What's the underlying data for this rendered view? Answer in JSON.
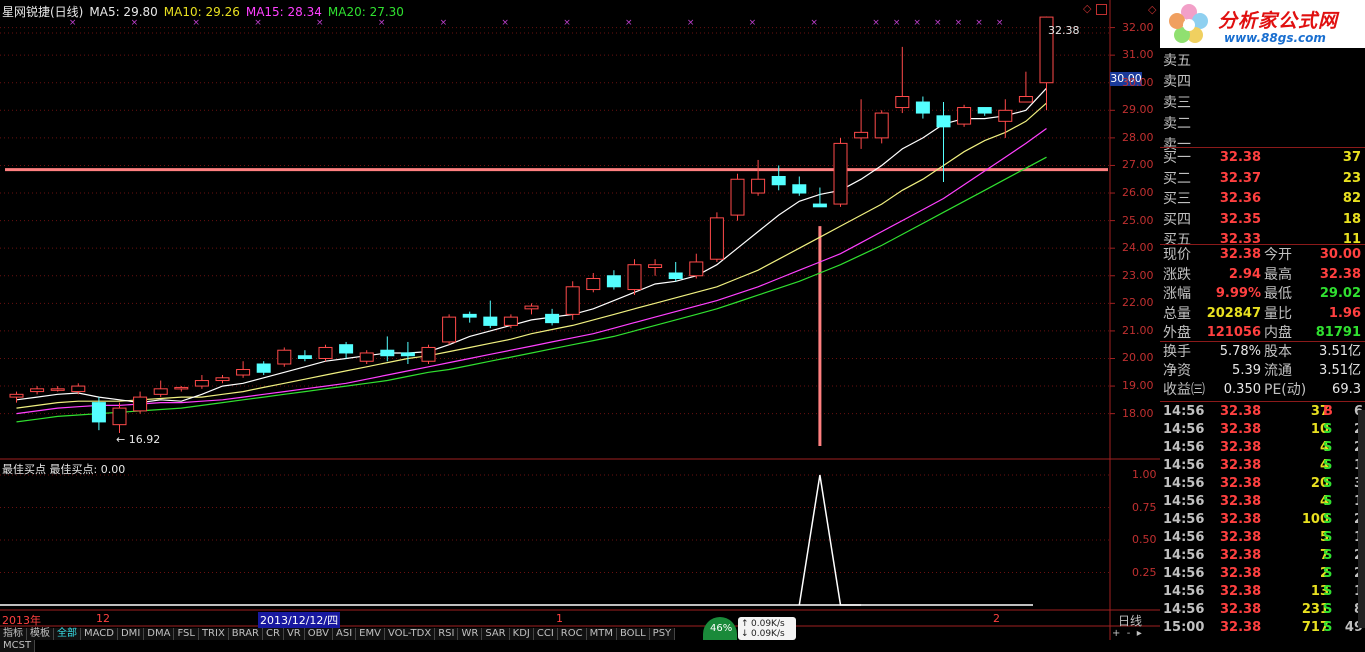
{
  "legend": {
    "name": "星网锐捷(日线)",
    "ma5": "MA5: 29.80",
    "ma10": "MA10: 29.26",
    "ma15": "MA15: 28.34",
    "ma20": "MA20: 27.30",
    "colors": {
      "ma5": "#ffffff",
      "ma10": "#f0f080",
      "ma15": "#ff40ff",
      "ma20": "#30e030"
    }
  },
  "price_axis": [
    "32.00",
    "31.00",
    "30.00",
    "29.00",
    "28.00",
    "27.00",
    "26.00",
    "25.00",
    "24.00",
    "23.00",
    "22.00",
    "21.00",
    "20.00",
    "19.00",
    "18.00"
  ],
  "price_cursor": "30.00",
  "high_label": "32.38",
  "low_label": "16.92",
  "indicator": {
    "title": "最佳买点",
    "value": "最佳买点: 0.00",
    "axis": [
      "1.00",
      "0.75",
      "0.50",
      "0.25"
    ]
  },
  "date_axis": {
    "year": "2013年",
    "m12": "12",
    "selected": "2013/12/12/四",
    "m1": "1",
    "m2": "2",
    "period": "日线"
  },
  "bottom_tabs": [
    "指标",
    "模板",
    "全部",
    "MACD",
    "DMI",
    "DMA",
    "FSL",
    "TRIX",
    "BRAR",
    "CR",
    "VR",
    "OBV",
    "ASI",
    "EMV",
    "VOL-TDX",
    "RSI",
    "WR",
    "SAR",
    "KDJ",
    "CCI",
    "ROC",
    "MTM",
    "BOLL",
    "PSY",
    "MCST"
  ],
  "network": {
    "percent": "46%",
    "up": "0.09K/s",
    "down": "0.09K/s"
  },
  "logo": {
    "brand": "分析家公式网",
    "url": "www.88gs.com"
  },
  "sell_levels": [
    "卖五",
    "卖四",
    "卖三",
    "卖二",
    "卖一"
  ],
  "buy_levels": [
    {
      "label": "买一",
      "price": "32.38",
      "vol": "37"
    },
    {
      "label": "买二",
      "price": "32.37",
      "vol": "23"
    },
    {
      "label": "买三",
      "price": "32.36",
      "vol": "82"
    },
    {
      "label": "买四",
      "price": "32.35",
      "vol": "18"
    },
    {
      "label": "买五",
      "price": "32.33",
      "vol": "11"
    }
  ],
  "quote": [
    {
      "l1": "现价",
      "v1": "32.38",
      "c1": "red",
      "l2": "今开",
      "v2": "30.00",
      "c2": "red"
    },
    {
      "l1": "涨跌",
      "v1": "2.94",
      "c1": "red",
      "l2": "最高",
      "v2": "32.38",
      "c2": "red"
    },
    {
      "l1": "涨幅",
      "v1": "9.99%",
      "c1": "red",
      "l2": "最低",
      "v2": "29.02",
      "c2": "green"
    },
    {
      "l1": "总量",
      "v1": "202847",
      "c1": "yellow",
      "l2": "量比",
      "v2": "1.96",
      "c2": "red"
    },
    {
      "l1": "外盘",
      "v1": "121056",
      "c1": "red",
      "l2": "内盘",
      "v2": "81791",
      "c2": "green"
    }
  ],
  "fundamentals": [
    {
      "l1": "换手",
      "v1": "5.78%",
      "l2": "股本",
      "v2": "3.51亿"
    },
    {
      "l1": "净资",
      "v1": "5.39",
      "l2": "流通",
      "v2": "3.51亿"
    },
    {
      "l1": "收益㈢",
      "v1": "0.350",
      "l2": "PE(动)",
      "v2": "69.3"
    }
  ],
  "ticks": [
    {
      "t": "14:56",
      "p": "32.38",
      "v": "37",
      "s": "B",
      "n": "6"
    },
    {
      "t": "14:56",
      "p": "32.38",
      "v": "10",
      "s": "S",
      "n": "2"
    },
    {
      "t": "14:56",
      "p": "32.38",
      "v": "4",
      "s": "S",
      "n": "2"
    },
    {
      "t": "14:56",
      "p": "32.38",
      "v": "4",
      "s": "S",
      "n": "1"
    },
    {
      "t": "14:56",
      "p": "32.38",
      "v": "20",
      "s": "S",
      "n": "3"
    },
    {
      "t": "14:56",
      "p": "32.38",
      "v": "4",
      "s": "S",
      "n": "1"
    },
    {
      "t": "14:56",
      "p": "32.38",
      "v": "100",
      "s": "S",
      "n": "2"
    },
    {
      "t": "14:56",
      "p": "32.38",
      "v": "5",
      "s": "S",
      "n": "1"
    },
    {
      "t": "14:56",
      "p": "32.38",
      "v": "7",
      "s": "S",
      "n": "2"
    },
    {
      "t": "14:56",
      "p": "32.38",
      "v": "2",
      "s": "S",
      "n": "2"
    },
    {
      "t": "14:56",
      "p": "32.38",
      "v": "13",
      "s": "S",
      "n": "1"
    },
    {
      "t": "14:56",
      "p": "32.38",
      "v": "231",
      "s": "S",
      "n": "8"
    },
    {
      "t": "15:00",
      "p": "32.38",
      "v": "717",
      "s": "S",
      "n": "49"
    }
  ],
  "chart_data": {
    "type": "candlestick",
    "candles": [
      [
        18.6,
        18.8,
        18.4,
        18.7
      ],
      [
        18.8,
        19.0,
        18.7,
        18.9
      ],
      [
        18.9,
        19.0,
        18.8,
        18.9
      ],
      [
        18.8,
        19.1,
        18.7,
        19.0
      ],
      [
        18.4,
        18.6,
        17.4,
        17.7
      ],
      [
        17.6,
        18.4,
        17.3,
        18.2
      ],
      [
        18.1,
        18.8,
        18.0,
        18.6
      ],
      [
        18.7,
        19.2,
        18.6,
        18.9
      ],
      [
        18.9,
        19.0,
        18.8,
        18.95
      ],
      [
        19.0,
        19.4,
        18.9,
        19.2
      ],
      [
        19.2,
        19.4,
        19.1,
        19.3
      ],
      [
        19.4,
        19.9,
        19.3,
        19.6
      ],
      [
        19.8,
        19.9,
        19.4,
        19.5
      ],
      [
        19.8,
        20.4,
        19.7,
        20.3
      ],
      [
        20.1,
        20.3,
        19.9,
        20.0
      ],
      [
        20.0,
        20.5,
        19.9,
        20.4
      ],
      [
        20.5,
        20.6,
        20.0,
        20.2
      ],
      [
        19.9,
        20.3,
        19.8,
        20.2
      ],
      [
        20.3,
        20.8,
        19.9,
        20.1
      ],
      [
        20.2,
        20.6,
        19.8,
        20.1
      ],
      [
        19.9,
        20.5,
        19.8,
        20.4
      ],
      [
        20.6,
        21.6,
        20.5,
        21.5
      ],
      [
        21.6,
        21.7,
        21.3,
        21.5
      ],
      [
        21.5,
        22.1,
        21.1,
        21.2
      ],
      [
        21.2,
        21.6,
        21.1,
        21.5
      ],
      [
        21.8,
        22.0,
        21.6,
        21.9
      ],
      [
        21.6,
        21.8,
        21.2,
        21.3
      ],
      [
        21.6,
        22.8,
        21.4,
        22.6
      ],
      [
        22.5,
        23.1,
        22.4,
        22.9
      ],
      [
        23.0,
        23.2,
        22.5,
        22.6
      ],
      [
        22.5,
        23.6,
        22.3,
        23.4
      ],
      [
        23.3,
        23.6,
        23.0,
        23.4
      ],
      [
        23.1,
        23.5,
        22.8,
        22.9
      ],
      [
        23.0,
        23.8,
        22.9,
        23.5
      ],
      [
        23.6,
        25.3,
        23.5,
        25.1
      ],
      [
        25.2,
        26.7,
        25.0,
        26.5
      ],
      [
        26.0,
        27.2,
        25.9,
        26.5
      ],
      [
        26.6,
        27.0,
        26.1,
        26.3
      ],
      [
        26.3,
        26.6,
        25.9,
        26.0
      ],
      [
        25.6,
        26.2,
        25.5,
        25.5
      ],
      [
        25.6,
        28.0,
        25.5,
        27.8
      ],
      [
        28.0,
        29.4,
        27.6,
        28.2
      ],
      [
        28.0,
        29.0,
        27.8,
        28.9
      ],
      [
        29.1,
        31.3,
        28.9,
        29.5
      ],
      [
        29.3,
        29.5,
        28.7,
        28.9
      ],
      [
        28.8,
        29.3,
        26.4,
        28.4
      ],
      [
        28.5,
        29.2,
        28.4,
        29.1
      ],
      [
        29.1,
        29.1,
        28.8,
        28.9
      ],
      [
        28.6,
        29.4,
        28.0,
        29.0
      ],
      [
        29.3,
        30.4,
        29.3,
        29.5
      ],
      [
        30.0,
        32.4,
        29.0,
        32.38
      ]
    ],
    "ma5": [
      18.5,
      18.6,
      18.7,
      18.75,
      18.6,
      18.5,
      18.4,
      18.5,
      18.45,
      18.7,
      19.0,
      19.1,
      19.3,
      19.5,
      19.7,
      19.9,
      20.0,
      20.1,
      20.2,
      20.2,
      20.25,
      20.5,
      20.8,
      21.0,
      21.2,
      21.4,
      21.5,
      21.6,
      21.8,
      22.1,
      22.4,
      22.7,
      22.8,
      23.0,
      23.4,
      24.0,
      24.6,
      25.2,
      25.7,
      25.95,
      26.1,
      26.5,
      27.0,
      27.6,
      28.0,
      28.5,
      28.7,
      28.7,
      28.8,
      29.0,
      29.8
    ],
    "ma10": [
      18.2,
      18.3,
      18.4,
      18.45,
      18.45,
      18.45,
      18.5,
      18.55,
      18.6,
      18.6,
      18.7,
      18.8,
      18.95,
      19.1,
      19.25,
      19.4,
      19.55,
      19.7,
      19.85,
      20.0,
      20.1,
      20.25,
      20.4,
      20.55,
      20.7,
      20.9,
      21.05,
      21.2,
      21.4,
      21.6,
      21.8,
      22.0,
      22.2,
      22.4,
      22.6,
      22.9,
      23.2,
      23.6,
      24.0,
      24.4,
      24.8,
      25.2,
      25.6,
      26.1,
      26.5,
      27.0,
      27.5,
      27.9,
      28.2,
      28.6,
      29.26
    ],
    "ma15": [
      18.0,
      18.1,
      18.2,
      18.25,
      18.3,
      18.3,
      18.35,
      18.4,
      18.4,
      18.45,
      18.5,
      18.6,
      18.7,
      18.8,
      18.9,
      19.0,
      19.1,
      19.25,
      19.4,
      19.55,
      19.7,
      19.85,
      20.0,
      20.15,
      20.3,
      20.45,
      20.6,
      20.75,
      20.9,
      21.1,
      21.3,
      21.5,
      21.7,
      21.9,
      22.1,
      22.35,
      22.6,
      22.9,
      23.2,
      23.5,
      23.8,
      24.2,
      24.6,
      25.0,
      25.4,
      25.8,
      26.3,
      26.8,
      27.3,
      27.8,
      28.34
    ],
    "ma20": [
      17.7,
      17.8,
      17.9,
      17.95,
      18.0,
      18.05,
      18.1,
      18.15,
      18.2,
      18.3,
      18.4,
      18.5,
      18.6,
      18.7,
      18.8,
      18.9,
      19.0,
      19.1,
      19.2,
      19.35,
      19.5,
      19.6,
      19.75,
      19.9,
      20.05,
      20.2,
      20.35,
      20.5,
      20.65,
      20.8,
      21.0,
      21.2,
      21.4,
      21.6,
      21.8,
      22.05,
      22.3,
      22.55,
      22.8,
      23.1,
      23.4,
      23.75,
      24.1,
      24.5,
      24.9,
      25.3,
      25.7,
      26.1,
      26.5,
      26.9,
      27.3
    ],
    "support_line": 26.85,
    "signal_index": 39,
    "indicator_values": [
      0,
      0,
      0,
      0,
      0,
      0,
      0,
      0,
      0,
      0,
      0,
      0,
      0,
      0,
      0,
      0,
      0,
      0,
      0,
      0,
      0,
      0,
      0,
      0,
      0,
      0,
      0,
      0,
      0,
      0,
      0,
      0,
      0,
      0,
      0,
      0,
      0,
      0,
      0,
      1,
      0,
      0,
      0,
      0,
      0,
      0,
      0,
      0,
      0,
      0,
      0
    ],
    "ylim": [
      16.5,
      33.0
    ],
    "ind_ylim": [
      0,
      1.1
    ]
  }
}
